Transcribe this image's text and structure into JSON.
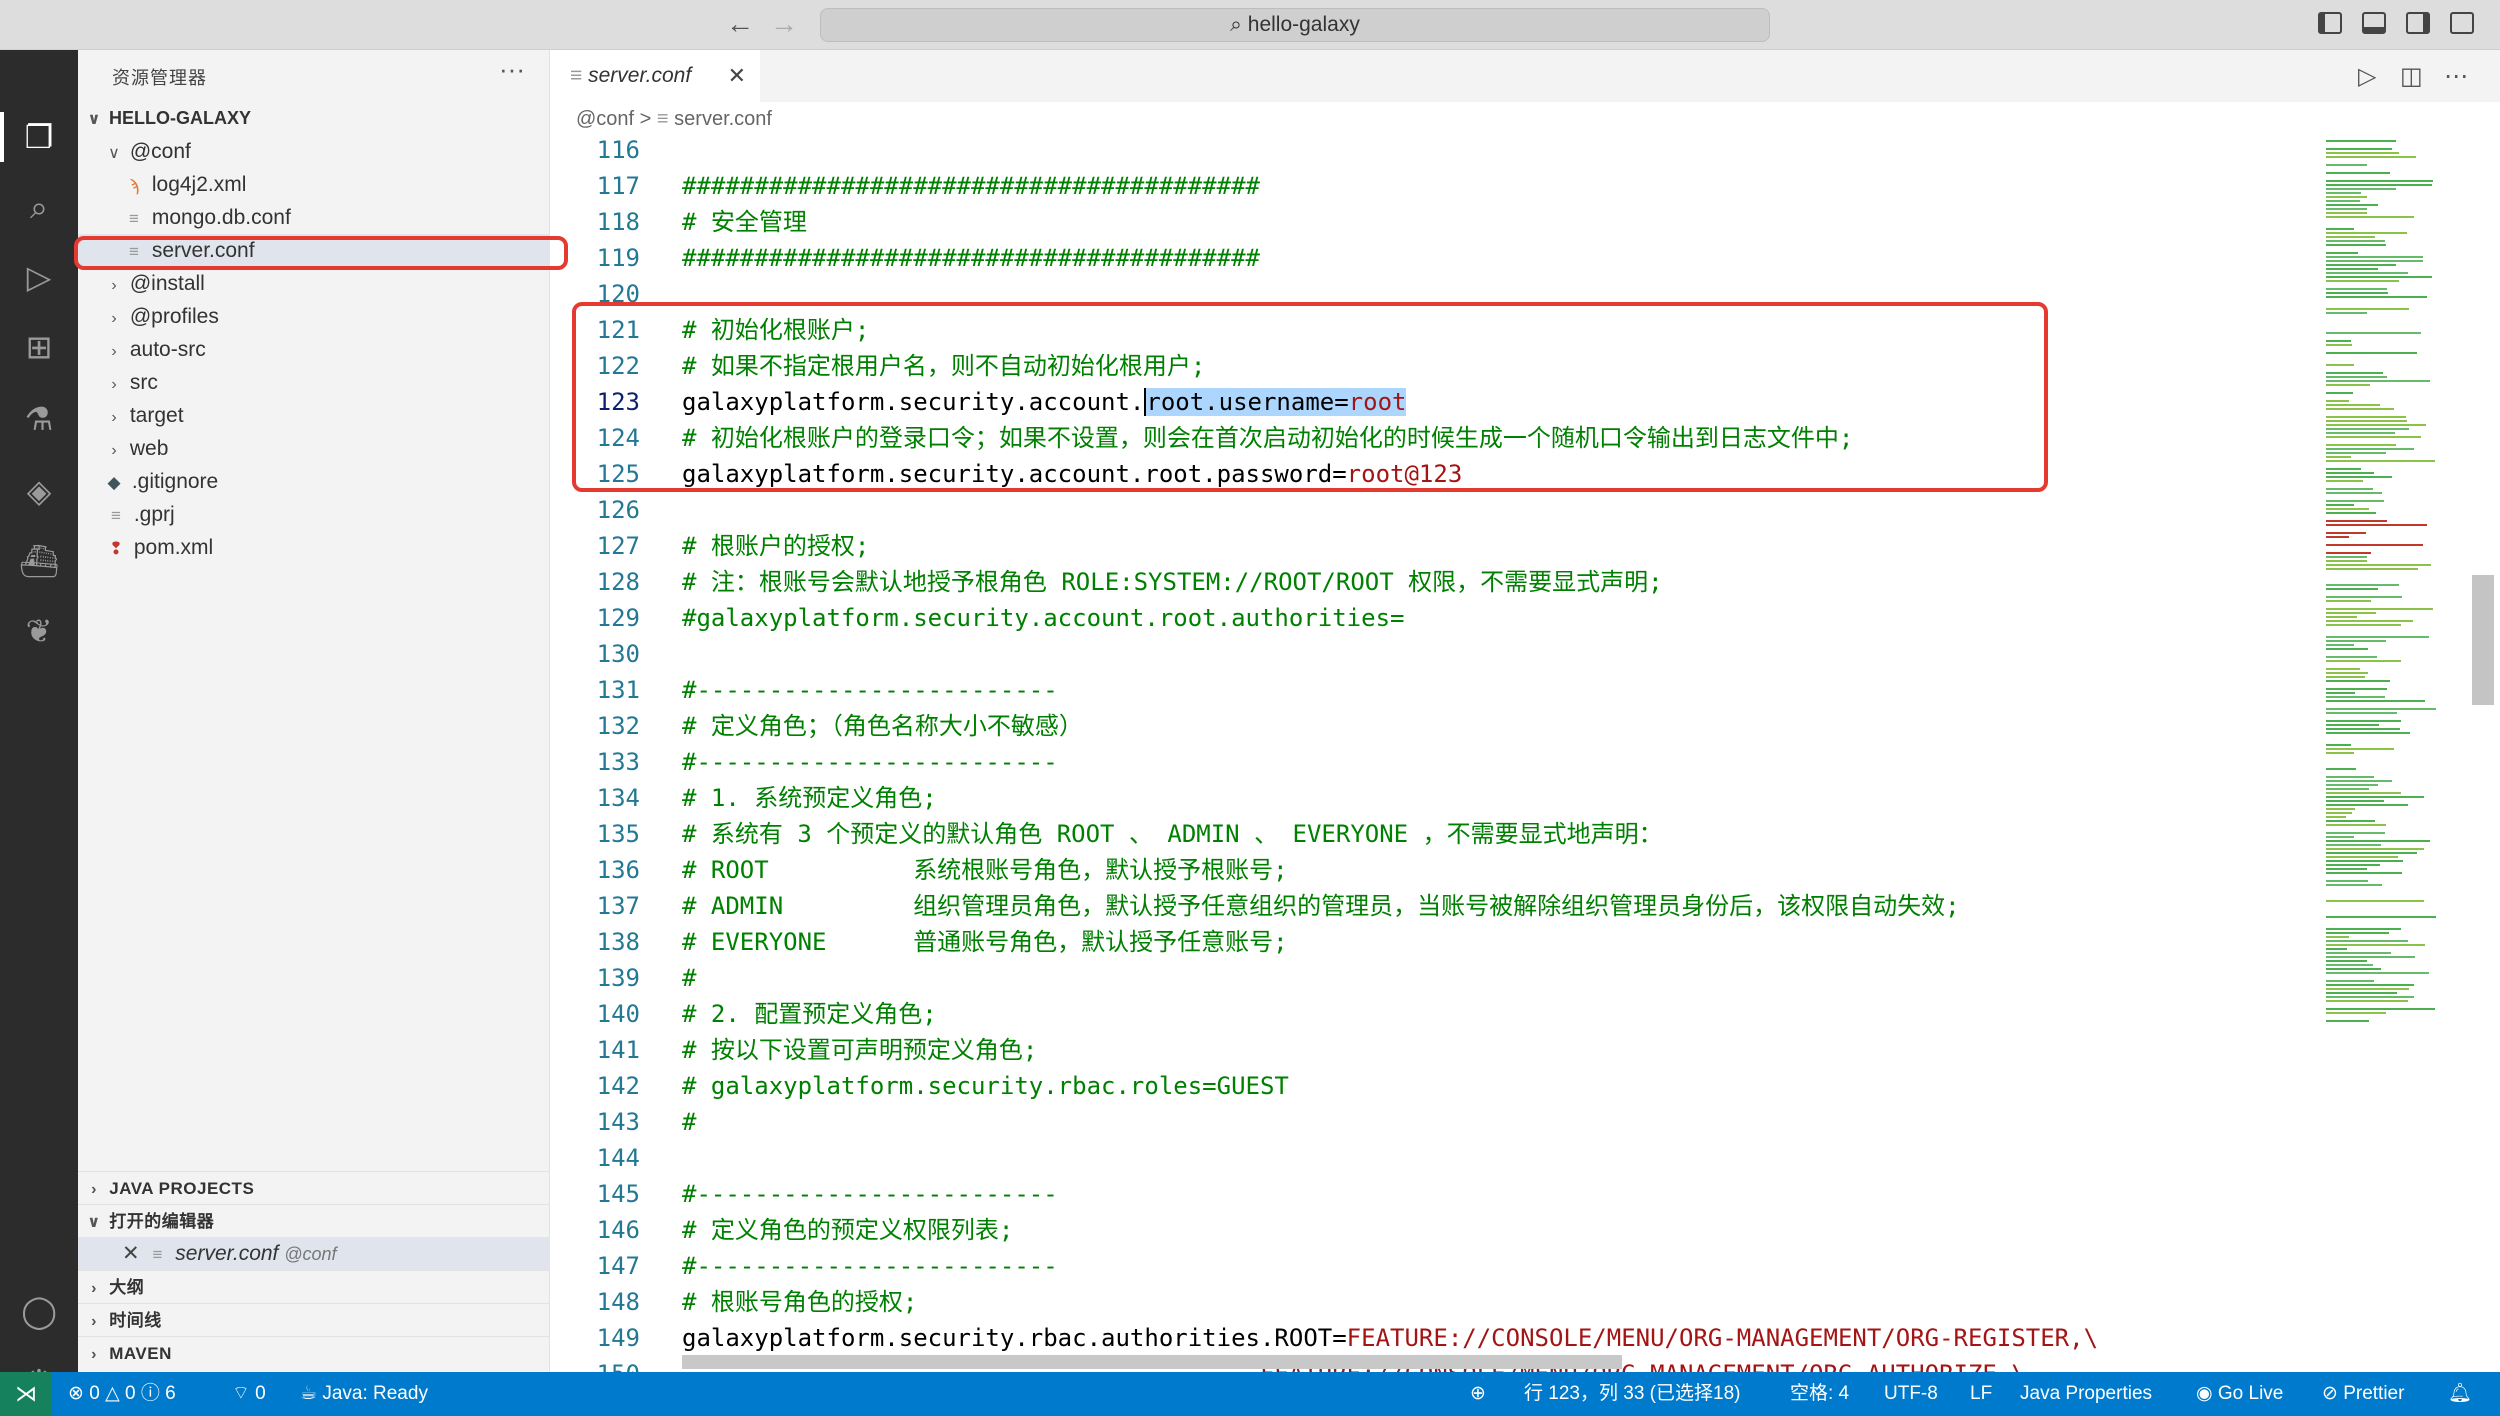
{
  "window": {
    "title": "hello-galaxy"
  },
  "sidebar": {
    "header": "资源管理器",
    "more": "···",
    "root": "HELLO-GALAXY",
    "tree": [
      {
        "label": "@conf",
        "chev": "∨",
        "icon": ""
      },
      {
        "label": "log4j2.xml",
        "chev": "",
        "icon": "rss-icon"
      },
      {
        "label": "mongo.db.conf",
        "chev": "",
        "icon": "lines-icon"
      },
      {
        "label": "server.conf",
        "chev": "",
        "icon": "lines-icon"
      },
      {
        "label": "@install",
        "chev": ">",
        "icon": ""
      },
      {
        "label": "@profiles",
        "chev": ">",
        "icon": ""
      },
      {
        "label": "auto-src",
        "chev": ">",
        "icon": ""
      },
      {
        "label": "src",
        "chev": ">",
        "icon": ""
      },
      {
        "label": "target",
        "chev": ">",
        "icon": ""
      },
      {
        "label": "web",
        "chev": ">",
        "icon": ""
      },
      {
        "label": ".gitignore",
        "chev": "",
        "icon": "git-icon"
      },
      {
        "label": ".gprj",
        "chev": "",
        "icon": "lines-icon"
      },
      {
        "label": "pom.xml",
        "chev": "",
        "icon": "maven-icon"
      }
    ],
    "sections": {
      "java_projects": "JAVA PROJECTS",
      "open_editors": "打开的编辑器",
      "outline": "大纲",
      "timeline": "时间线",
      "maven": "MAVEN"
    },
    "open_editor": {
      "close": "✕",
      "name": "server.conf",
      "folder": "@conf"
    }
  },
  "tab": {
    "label": "server.conf",
    "close": "✕"
  },
  "breadcrumb": {
    "folder": "@conf",
    "sep": ">",
    "file": "server.conf"
  },
  "editor": {
    "lines": [
      {
        "n": "116",
        "t": "",
        "k": "plain"
      },
      {
        "n": "117",
        "t": "########################################",
        "k": "comment"
      },
      {
        "n": "118",
        "t": "# 安全管理",
        "k": "comment"
      },
      {
        "n": "119",
        "t": "########################################",
        "k": "comment"
      },
      {
        "n": "120",
        "t": "",
        "k": "plain"
      },
      {
        "n": "121",
        "t": "# 初始化根账户;",
        "k": "comment"
      },
      {
        "n": "122",
        "t": "# 如果不指定根用户名，则不自动初始化根用户;",
        "k": "comment"
      },
      {
        "n": "123",
        "key": "galaxyplatform.security.account.",
        "sel": "root.username=",
        "v": "root",
        "k": "selected"
      },
      {
        "n": "124",
        "t": "# 初始化根账户的登录口令；如果不设置，则会在首次启动初始化的时候生成一个随机口令输出到日志文件中;",
        "k": "comment"
      },
      {
        "n": "125",
        "key": "galaxyplatform.security.account.root.password=",
        "v": "root@123",
        "k": "kv"
      },
      {
        "n": "126",
        "t": "",
        "k": "plain"
      },
      {
        "n": "127",
        "t": "# 根账户的授权;",
        "k": "comment"
      },
      {
        "n": "128",
        "t": "# 注：根账号会默认地授予根角色 ROLE:SYSTEM://ROOT/ROOT 权限，不需要显式声明;",
        "k": "comment"
      },
      {
        "n": "129",
        "t": "#galaxyplatform.security.account.root.authorities=",
        "k": "comment"
      },
      {
        "n": "130",
        "t": "",
        "k": "plain"
      },
      {
        "n": "131",
        "t": "#-------------------------",
        "k": "comment"
      },
      {
        "n": "132",
        "t": "# 定义角色；（角色名称大小不敏感）",
        "k": "comment"
      },
      {
        "n": "133",
        "t": "#-------------------------",
        "k": "comment"
      },
      {
        "n": "134",
        "t": "# 1. 系统预定义角色;",
        "k": "comment"
      },
      {
        "n": "135",
        "t": "# 系统有 3 个预定义的默认角色 ROOT 、 ADMIN 、 EVERYONE ，不需要显式地声明：",
        "k": "comment"
      },
      {
        "n": "136",
        "t": "# ROOT          系统根账号角色，默认授予根账号;",
        "k": "comment"
      },
      {
        "n": "137",
        "t": "# ADMIN         组织管理员角色，默认授予任意组织的管理员，当账号被解除组织管理员身份后，该权限自动失效;",
        "k": "comment"
      },
      {
        "n": "138",
        "t": "# EVERYONE      普通账号角色，默认授予任意账号;",
        "k": "comment"
      },
      {
        "n": "139",
        "t": "#",
        "k": "comment"
      },
      {
        "n": "140",
        "t": "# 2. 配置预定义角色;",
        "k": "comment"
      },
      {
        "n": "141",
        "t": "# 按以下设置可声明预定义角色;",
        "k": "comment"
      },
      {
        "n": "142",
        "t": "# galaxyplatform.security.rbac.roles=GUEST",
        "k": "comment"
      },
      {
        "n": "143",
        "t": "#",
        "k": "comment"
      },
      {
        "n": "144",
        "t": "",
        "k": "plain"
      },
      {
        "n": "145",
        "t": "#-------------------------",
        "k": "comment"
      },
      {
        "n": "146",
        "t": "# 定义角色的预定义权限列表;",
        "k": "comment"
      },
      {
        "n": "147",
        "t": "#-------------------------",
        "k": "comment"
      },
      {
        "n": "148",
        "t": "# 根账号角色的授权;",
        "k": "comment"
      },
      {
        "n": "149",
        "key": "galaxyplatform.security.rbac.authorities.ROOT=",
        "v": "FEATURE://CONSOLE/MENU/ORG-MANAGEMENT/ORG-REGISTER,\\",
        "k": "kv"
      },
      {
        "n": "150",
        "key": "                                        ",
        "v": "FEATURE://CONSOLE/MENU/ORG-MANAGEMENT/ORG-AUTHORIZE,\\",
        "k": "kv"
      }
    ]
  },
  "status": {
    "errors": "0",
    "warnings": "0",
    "info": "6",
    "ports": "0",
    "java": "Java: Ready",
    "position": "行 123，列 33 (已选择18)",
    "spaces": "空格: 4",
    "encoding": "UTF-8",
    "eol": "LF",
    "language": "Java Properties",
    "golive": "Go Live",
    "prettier": "Prettier"
  },
  "colors": {
    "accent": "#007acc",
    "highlight_box": "#e53a2f",
    "comment": "#008000",
    "value": "#a31515",
    "selection": "#add6ff"
  }
}
